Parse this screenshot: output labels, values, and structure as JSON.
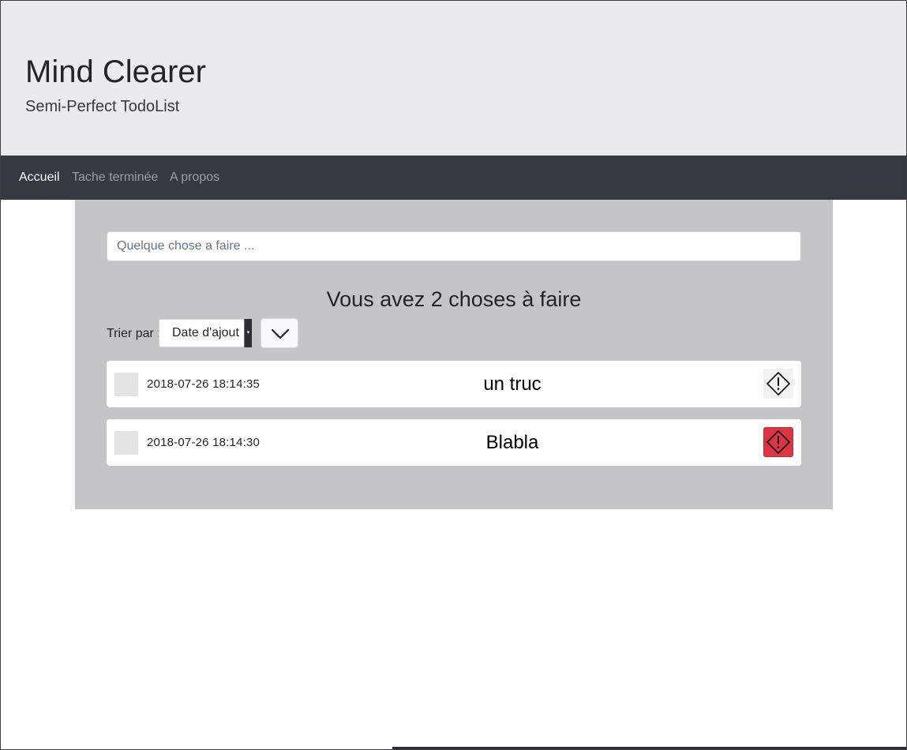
{
  "header": {
    "title": "Mind Clearer",
    "subtitle": "Semi-Perfect TodoList"
  },
  "nav": {
    "items": [
      {
        "label": "Accueil",
        "active": true
      },
      {
        "label": "Tache terminée",
        "active": false
      },
      {
        "label": "A propos",
        "active": false
      }
    ]
  },
  "form": {
    "input_value": "",
    "input_placeholder": "Quelque chose a faire ..."
  },
  "summary": {
    "heading": "Vous avez 2 choses à faire"
  },
  "sort": {
    "label": "Trier par :",
    "selected": "Date d'ajout",
    "order_icon": "chevron-down-icon"
  },
  "todos": [
    {
      "date": "2018-07-26 18:14:35",
      "title": "un truc",
      "priority_icon": "warning-diamond-icon",
      "urgent": false
    },
    {
      "date": "2018-07-26 18:14:30",
      "title": "Blabla",
      "priority_icon": "warning-diamond-icon",
      "urgent": true
    }
  ],
  "colors": {
    "header_bg": "#e9ecef",
    "navbar_bg": "#343a40",
    "panel_bg": "#c4c5c7",
    "urgent": "#dc3545"
  }
}
